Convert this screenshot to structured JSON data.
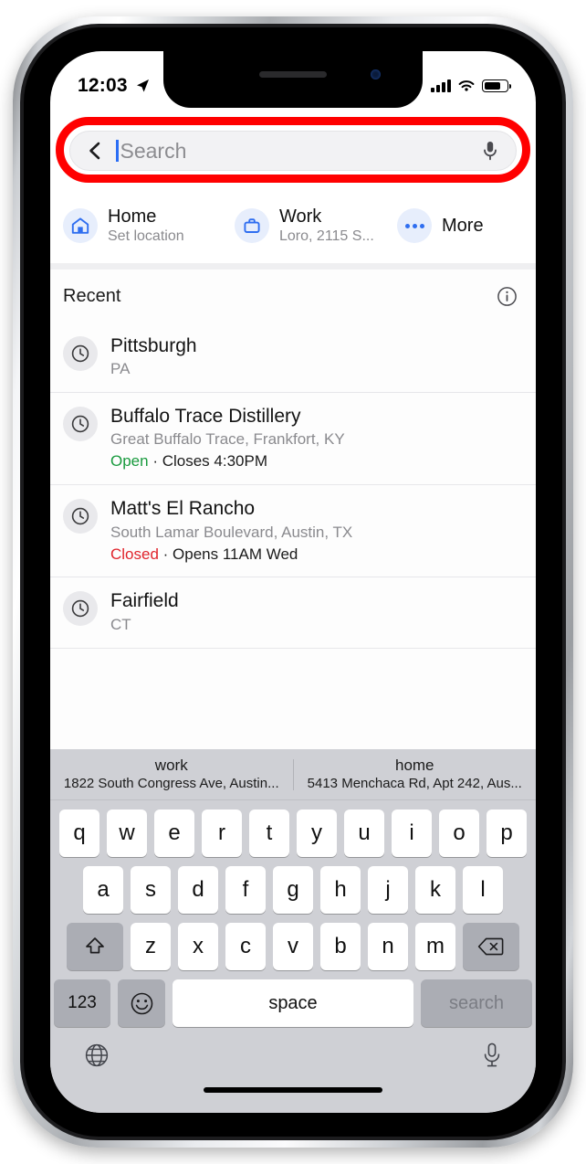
{
  "status_bar": {
    "time": "12:03",
    "location_arrow_icon": "location-arrow-icon",
    "cellular_icon": "signal-bars-icon",
    "wifi_icon": "wifi-icon",
    "battery_icon": "battery-icon"
  },
  "search": {
    "back_icon": "chevron-left-icon",
    "placeholder": "Search",
    "value": "",
    "mic_icon": "microphone-icon",
    "highlight_color": "#ff0000"
  },
  "shortcuts": [
    {
      "title": "Home",
      "subtitle": "Set location",
      "icon": "house-icon"
    },
    {
      "title": "Work",
      "subtitle": "Loro, 2115 S...",
      "icon": "briefcase-icon"
    },
    {
      "title": "More",
      "subtitle": "",
      "icon": "ellipsis-icon"
    }
  ],
  "recent": {
    "header": "Recent",
    "info_icon": "info-circle-icon",
    "items": [
      {
        "icon": "clock-icon",
        "title": "Pittsburgh",
        "subtitle": "PA",
        "status": "",
        "status_state": "",
        "status_detail": ""
      },
      {
        "icon": "clock-icon",
        "title": "Buffalo Trace Distillery",
        "subtitle": "Great Buffalo Trace, Frankfort, KY",
        "status": "Open",
        "status_state": "open",
        "status_detail": " · Closes 4:30PM"
      },
      {
        "icon": "clock-icon",
        "title": "Matt's El Rancho",
        "subtitle": "South Lamar Boulevard, Austin, TX",
        "status": "Closed",
        "status_state": "closed",
        "status_detail": " · Opens 11AM Wed"
      },
      {
        "icon": "clock-icon",
        "title": "Fairfield",
        "subtitle": "CT",
        "status": "",
        "status_state": "",
        "status_detail": ""
      }
    ]
  },
  "keyboard": {
    "suggestions": [
      {
        "title": "work",
        "subtitle": "1822 South Congress Ave, Austin..."
      },
      {
        "title": "home",
        "subtitle": "5413 Menchaca Rd, Apt 242, Aus..."
      }
    ],
    "row1": [
      "q",
      "w",
      "e",
      "r",
      "t",
      "y",
      "u",
      "i",
      "o",
      "p"
    ],
    "row2": [
      "a",
      "s",
      "d",
      "f",
      "g",
      "h",
      "j",
      "k",
      "l"
    ],
    "row3": [
      "z",
      "x",
      "c",
      "v",
      "b",
      "n",
      "m"
    ],
    "shift_icon": "shift-arrow-icon",
    "delete_icon": "backspace-icon",
    "numbers_label": "123",
    "emoji_icon": "smiley-icon",
    "space_label": "space",
    "search_label": "search",
    "globe_icon": "globe-icon",
    "dictation_icon": "microphone-icon"
  },
  "colors": {
    "accent_blue": "#2f6ef0",
    "open_green": "#189a3d",
    "closed_red": "#e0232b",
    "keyboard_bg": "#cfd0d5"
  }
}
